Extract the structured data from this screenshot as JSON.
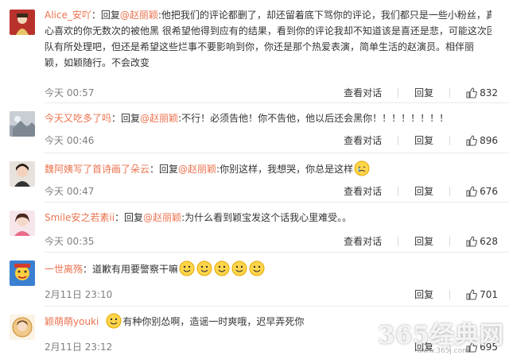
{
  "actions": {
    "reply_label": "回复",
    "chat_label": "查看对话"
  },
  "comments": [
    {
      "username": "Alice_安吖",
      "reply_prefix": "：回复",
      "mention": "@赵丽颖",
      "text_lines": [
        ":他把我们的评论都删了，却还留着底下骂你的评论，我们都只是一些小粉丝，真",
        "心喜欢的你无数次的被他黑 很希望他得到应有的结果，看到你的评论我却不知道该是喜还是悲，可能这次团",
        "队有所处理吧，但还是希望这些烂事不要影响到你，你还是那个热爱表演，简单生活的赵演员。相伴丽",
        "颖，如颖随行。不会改变"
      ],
      "time": "今天 00:57",
      "likes": "832",
      "has_chat": true
    },
    {
      "username": "今天又吃多了吗",
      "reply_prefix": "：回复",
      "mention": "@赵丽颖",
      "text_lines": [
        ":不行！必须告他！你不告他，他以后还会黑你！！！！！！！！"
      ],
      "time": "今天 00:46",
      "likes": "896",
      "has_chat": true
    },
    {
      "username": "魏阿姨写了首诗画了朵云",
      "reply_prefix": "：回复",
      "mention": "@赵丽颖",
      "text_lines": [
        ":你别这样，我想哭，你总是这样"
      ],
      "time": "今天 00:47",
      "likes": "676",
      "has_chat": true
    },
    {
      "username": "Smile安之若素ii",
      "reply_prefix": "：回复",
      "mention": "@赵丽颖",
      "text_lines": [
        ":为什么看到颖宝发这个话我心里难受。。"
      ],
      "time": "今天 00:35",
      "likes": "628",
      "has_chat": true
    },
    {
      "username": "一世离殇",
      "reply_prefix": "",
      "mention": "",
      "text_lines": [
        "：道歉有用要警察干嘛"
      ],
      "time": "2月11日 23:10",
      "likes": "701",
      "has_chat": false
    },
    {
      "username": "颖萌萌youki",
      "reply_prefix": "",
      "mention": "",
      "text_lines": [
        "有种你别怂啊，造谣一时爽哦，迟早弄死你"
      ],
      "time": "2月11日 23:12",
      "likes": "695",
      "has_chat": false
    }
  ],
  "watermark": {
    "main": "365经典网",
    "sub": "www.365j.com"
  },
  "colors": {
    "link": "#eb7350",
    "time": "#808080",
    "divider": "#eaeaea"
  }
}
